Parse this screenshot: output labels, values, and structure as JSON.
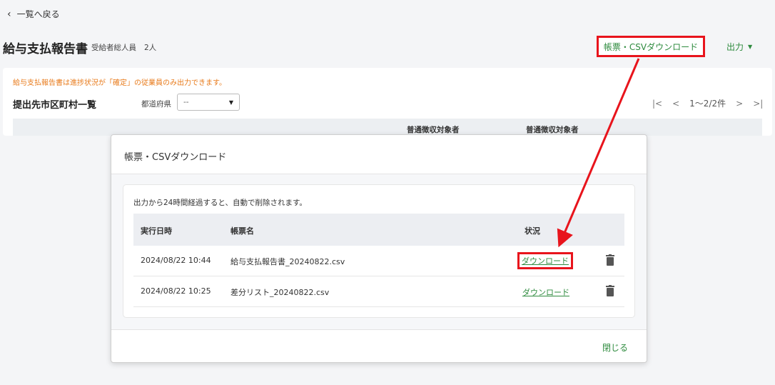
{
  "nav": {
    "back_label": "一覧へ戻る"
  },
  "header": {
    "title": "給与支払報告書",
    "recipient_label": "受給者総人員",
    "recipient_count": "2人",
    "csv_download_label": "帳票・CSVダウンロード",
    "output_label": "出力"
  },
  "main": {
    "warning": "給与支払報告書は進捗状況が「確定」の従業員のみ出力できます。",
    "section_title": "提出先市区町村一覧",
    "prefecture_label": "都道府県",
    "prefecture_value": "--",
    "pager": {
      "first": "|<",
      "prev": "<",
      "range": "1〜2/2件",
      "next": ">",
      "last": ">|"
    },
    "table_headers_visible": [
      "普通徴収対象者",
      "普通徴収対象者"
    ]
  },
  "modal": {
    "title": "帳票・CSVダウンロード",
    "notice": "出力から24時間経過すると、自動で削除されます。",
    "columns": [
      "実行日時",
      "帳票名",
      "状況"
    ],
    "rows": [
      {
        "datetime": "2024/08/22 10:44",
        "name": "給与支払報告書_20240822.csv",
        "status": "ダウンロード"
      },
      {
        "datetime": "2024/08/22 10:25",
        "name": "差分リスト_20240822.csv",
        "status": "ダウンロード"
      }
    ],
    "close_label": "閉じる"
  },
  "colors": {
    "accent_green": "#2e8b3e",
    "highlight_red": "#e8141c",
    "warning_orange": "#e87a1a"
  }
}
